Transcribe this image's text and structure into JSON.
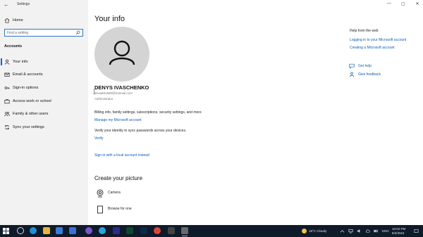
{
  "app": {
    "title": "Settings"
  },
  "sidebar": {
    "home_label": "Home",
    "search_placeholder": "Find a setting",
    "section_title": "Accounts",
    "items": [
      {
        "label": "Your info",
        "icon": "person-icon",
        "selected": true
      },
      {
        "label": "Email & accounts",
        "icon": "email-icon"
      },
      {
        "label": "Sign-in options",
        "icon": "key-icon"
      },
      {
        "label": "Access work or school",
        "icon": "briefcase-icon"
      },
      {
        "label": "Family & other users",
        "icon": "people-icon"
      },
      {
        "label": "Sync your settings",
        "icon": "sync-icon"
      }
    ]
  },
  "main": {
    "title": "Your info",
    "user": {
      "name": "DENYS IVASCHENKO",
      "email": "dnoa691980@hotmail.com",
      "role": "Administrator"
    },
    "billing_text": "Billing info, family settings, subscriptions, security settings, and more",
    "manage_link": "Manage my Microsoft account",
    "verify_text": "Verify your identity to sync passwords across your devices.",
    "verify_link": "Verify",
    "local_account_link": "Sign in with a local account instead",
    "create_picture_title": "Create your picture",
    "picture_options": [
      {
        "label": "Camera",
        "icon": "camera-icon"
      },
      {
        "label": "Browse for one",
        "icon": "browse-file-icon"
      }
    ]
  },
  "help": {
    "title": "Help from the web",
    "links": [
      "Logging in to your Microsoft account",
      "Creating a Microsoft account"
    ],
    "get_help": "Get help",
    "give_feedback": "Give feedback"
  },
  "taskbar": {
    "weather": "18°C  Cloudy",
    "language": "ENG",
    "time": "10:02 PM",
    "date": "8/2/2022"
  },
  "colors": {
    "accent": "#0a64c8",
    "link": "#0a5fb5",
    "taskbar": "#0f1a2a",
    "sidebar": "#f2f2f2"
  }
}
